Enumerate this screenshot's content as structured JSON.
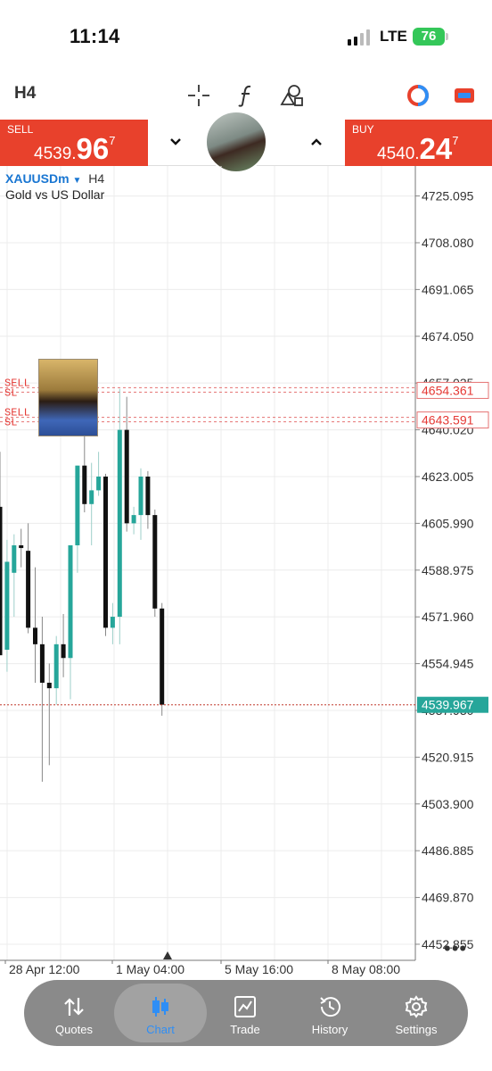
{
  "status_bar": {
    "time": "11:14",
    "network": "LTE",
    "battery": "76"
  },
  "toolbar": {
    "timeframe": "H4",
    "icons": [
      "crosshair-icon",
      "indicator-f-icon",
      "objects-icon",
      "color-ring-icon",
      "window-icon"
    ]
  },
  "trade": {
    "sell_label": "SELL",
    "sell_price_prefix": "4539.",
    "sell_price_big": "96",
    "sell_price_sup": "7",
    "buy_label": "BUY",
    "buy_price_prefix": "4540.",
    "buy_price_big": "24",
    "buy_price_sup": "7"
  },
  "chart": {
    "symbol": "XAUUSDm",
    "timeframe": "H4",
    "description": "Gold vs US Dollar",
    "order_labels": [
      "SELL",
      "SL",
      "SELL",
      "SL"
    ],
    "more_label": "•••"
  },
  "chart_data": {
    "type": "candlestick",
    "price_ticks": [
      "4725.095",
      "4708.080",
      "4691.065",
      "4674.050",
      "4657.035",
      "4640.020",
      "4623.005",
      "4605.990",
      "4588.975",
      "4571.960",
      "4554.945",
      "4537.930",
      "4520.915",
      "4503.900",
      "4486.885",
      "4469.870",
      "4452.855"
    ],
    "price_tick_values": [
      4725.095,
      4708.08,
      4691.065,
      4674.05,
      4657.035,
      4640.02,
      4623.005,
      4605.99,
      4588.975,
      4571.96,
      4554.945,
      4537.93,
      4520.915,
      4503.9,
      4486.885,
      4469.87,
      4452.855
    ],
    "ylim": [
      4447,
      4736
    ],
    "time_labels": [
      "28 Apr 12:00",
      "1 May 04:00",
      "5 May 16:00",
      "8 May 08:00"
    ],
    "current_price": "4539.967",
    "current_price_value": 4539.967,
    "order_lines": [
      {
        "label": "4654.361",
        "value": 4654.361
      },
      {
        "label": "4643.591",
        "value": 4643.591
      }
    ],
    "candles": [
      {
        "o": 4612,
        "h": 4632,
        "l": 4572,
        "c": 4558
      },
      {
        "o": 4560,
        "h": 4600,
        "l": 4552,
        "c": 4592
      },
      {
        "o": 4588,
        "h": 4602,
        "l": 4572,
        "c": 4598
      },
      {
        "o": 4598,
        "h": 4604,
        "l": 4590,
        "c": 4597
      },
      {
        "o": 4596,
        "h": 4606,
        "l": 4566,
        "c": 4568
      },
      {
        "o": 4568,
        "h": 4590,
        "l": 4548,
        "c": 4562
      },
      {
        "o": 4562,
        "h": 4572,
        "l": 4512,
        "c": 4548
      },
      {
        "o": 4548,
        "h": 4555,
        "l": 4518,
        "c": 4546
      },
      {
        "o": 4546,
        "h": 4565,
        "l": 4540,
        "c": 4562
      },
      {
        "o": 4562,
        "h": 4573,
        "l": 4550,
        "c": 4557
      },
      {
        "o": 4557,
        "h": 4598,
        "l": 4542,
        "c": 4598
      },
      {
        "o": 4598,
        "h": 4627,
        "l": 4588,
        "c": 4627
      },
      {
        "o": 4627,
        "h": 4639,
        "l": 4610,
        "c": 4613
      },
      {
        "o": 4613,
        "h": 4628,
        "l": 4598,
        "c": 4618
      },
      {
        "o": 4618,
        "h": 4632,
        "l": 4616,
        "c": 4623
      },
      {
        "o": 4623,
        "h": 4624,
        "l": 4565,
        "c": 4568
      },
      {
        "o": 4568,
        "h": 4577,
        "l": 4562,
        "c": 4572
      },
      {
        "o": 4572,
        "h": 4655,
        "l": 4562,
        "c": 4640
      },
      {
        "o": 4640,
        "h": 4652,
        "l": 4603,
        "c": 4606
      },
      {
        "o": 4606,
        "h": 4612,
        "l": 4602,
        "c": 4609
      },
      {
        "o": 4609,
        "h": 4626,
        "l": 4600,
        "c": 4623
      },
      {
        "o": 4623,
        "h": 4625,
        "l": 4604,
        "c": 4609
      },
      {
        "o": 4609,
        "h": 4611,
        "l": 4572,
        "c": 4575
      },
      {
        "o": 4575,
        "h": 4577,
        "l": 4536,
        "c": 4540
      }
    ]
  },
  "nav": {
    "items": [
      {
        "label": "Quotes",
        "icon": "quotes-icon"
      },
      {
        "label": "Chart",
        "icon": "chart-icon"
      },
      {
        "label": "Trade",
        "icon": "trade-icon"
      },
      {
        "label": "History",
        "icon": "history-icon"
      },
      {
        "label": "Settings",
        "icon": "settings-icon"
      }
    ],
    "active": "Chart"
  }
}
